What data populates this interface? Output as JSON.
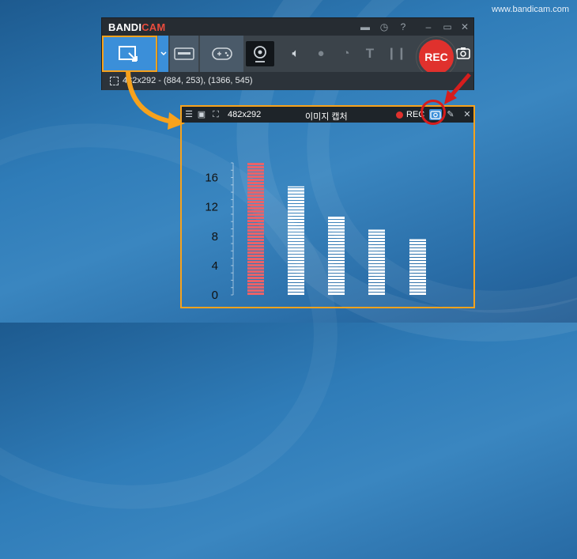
{
  "watermark": "www.bandicam.com",
  "app": {
    "logo_a": "BANDI",
    "logo_b": "CAM"
  },
  "toolbar": {
    "rec_label": "REC",
    "status": "482x292 - (884, 253), (1366, 545)"
  },
  "capture_window": {
    "size": "482x292",
    "title": "이미지 캡처",
    "rec_label": "REC"
  },
  "colors": {
    "accent": "#3b8fd9",
    "highlight": "#f7a21c",
    "rec": "#e0312d"
  },
  "chart_data": {
    "type": "bar",
    "categories": [
      "",
      "",
      "",
      "",
      ""
    ],
    "values": [
      18,
      14.8,
      10.7,
      8.9,
      7.6
    ],
    "colors": [
      "#e8636a",
      "#ffffff",
      "#ffffff",
      "#ffffff",
      "#ffffff"
    ],
    "yticks": [
      0,
      4,
      8,
      12,
      16
    ],
    "ylim": [
      0,
      18
    ],
    "title": "",
    "xlabel": "",
    "ylabel": ""
  }
}
